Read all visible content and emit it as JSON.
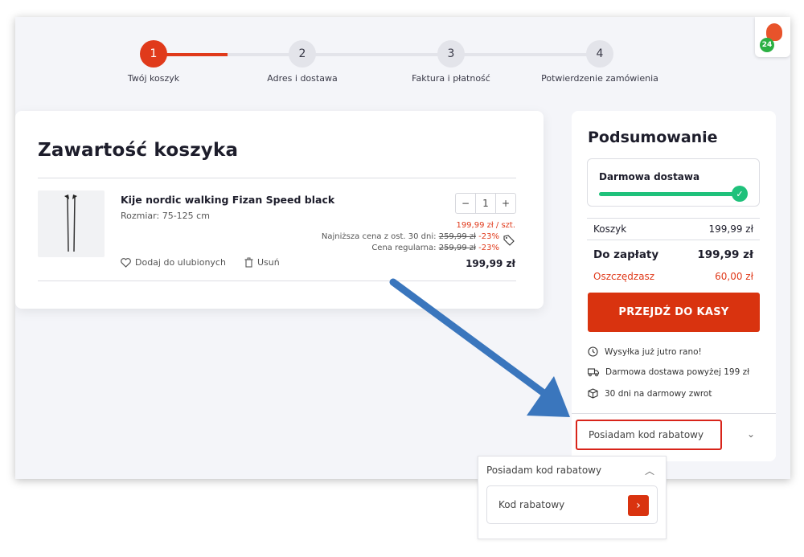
{
  "steps": [
    {
      "num": "1",
      "label": "Twój koszyk"
    },
    {
      "num": "2",
      "label": "Adres i dostawa"
    },
    {
      "num": "3",
      "label": "Faktura i płatność"
    },
    {
      "num": "4",
      "label": "Potwierdzenie zamówienia"
    }
  ],
  "badge": {
    "count": "24"
  },
  "cart": {
    "title": "Zawartość koszyka",
    "product": {
      "name": "Kije nordic walking Fizan Speed black",
      "size": "Rozmiar: 75-125 cm",
      "quantity": "1",
      "qty_minus": "−",
      "qty_plus": "+",
      "unit_price": "199,99 zł / szt.",
      "lowest_label": "Najniższa cena z ost. 30 dni:",
      "lowest_price": "259,99 zł",
      "lowest_discount": "-23%",
      "regular_label": "Cena regularna:",
      "regular_price": "259,99 zł",
      "regular_discount": "-23%",
      "total": "199,99 zł",
      "favorite_label": "Dodaj do ulubionych",
      "remove_label": "Usuń"
    }
  },
  "summary": {
    "title": "Podsumowanie",
    "free_shipping_label": "Darmowa dostawa",
    "free_shipping_progress": 1.0,
    "cart_label": "Koszyk",
    "cart_value": "199,99 zł",
    "to_pay_label": "Do zapłaty",
    "to_pay_value": "199,99 zł",
    "savings_label": "Oszczędzasz",
    "savings_value": "60,00 zł",
    "checkout_button": "PRZEJDŹ DO KASY",
    "info": [
      {
        "icon": "clock-icon",
        "text": "Wysyłka już jutro rano!"
      },
      {
        "icon": "truck-icon",
        "text": "Darmowa dostawa powyżej 199 zł"
      },
      {
        "icon": "box-icon",
        "text": "30 dni na darmowy zwrot"
      }
    ],
    "discount_toggle": "Posiadam kod rabatowy"
  },
  "popup": {
    "header": "Posiadam kod rabatowy",
    "input_label": "Kod rabatowy"
  },
  "colors": {
    "accent": "#d9330f",
    "success": "#1fc17b",
    "arrow": "#3a76bd"
  }
}
